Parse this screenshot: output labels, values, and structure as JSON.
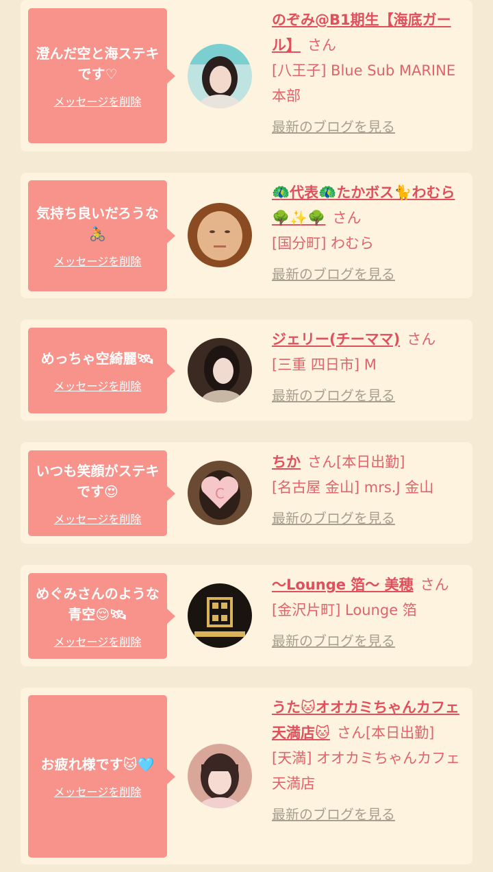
{
  "entries": [
    {
      "message": "澄んだ空と海ステキです♡",
      "delete_label": "メッセージを削除",
      "name": "のぞみ@B1期生【海底ガール】",
      "suffix": "さん",
      "shop": "[八王子] Blue Sub MARINE 本部",
      "blog_label": "最新のブログを見る"
    },
    {
      "message": "気持ち良いだろうな🚴",
      "delete_label": "メッセージを削除",
      "name": "🦚代表🦚たかボス🐈わむら🌳✨🌳",
      "suffix": "さん",
      "shop": "[国分町] わむら",
      "blog_label": "最新のブログを見る"
    },
    {
      "message": "めっちゃ空綺麗🛰",
      "delete_label": "メッセージを削除",
      "name": "ジェリー(チーママ)",
      "suffix": "さん",
      "shop": "[三重 四日市] M",
      "blog_label": "最新のブログを見る"
    },
    {
      "message": "いつも笑顔がステキです😍",
      "delete_label": "メッセージを削除",
      "name": "ちか",
      "suffix": "さん[本日出勤]",
      "shop": "[名古屋 金山] mrs.J 金山",
      "blog_label": "最新のブログを見る"
    },
    {
      "message": "めぐみさんのような青空😌🛰",
      "delete_label": "メッセージを削除",
      "name": "〜Lounge 箔〜 美穂",
      "suffix": "さん",
      "shop": "[金沢片町] Lounge 箔",
      "blog_label": "最新のブログを見る"
    },
    {
      "message": "お疲れ様です🐱🩵",
      "delete_label": "メッセージを削除",
      "name": "うた🐱オオカミちゃんカフェ天満店🐱",
      "suffix": "さん[本日出勤]",
      "shop": "[天満] オオカミちゃんカフェ天満店",
      "blog_label": "最新のブログを見る"
    }
  ],
  "colors": {
    "page_bg": "#f5ead3",
    "card_bg": "#fdf3de",
    "bubble": "#f7938a",
    "name": "#e0505c",
    "text": "#e0636b",
    "link_gray": "#a89f8f"
  }
}
